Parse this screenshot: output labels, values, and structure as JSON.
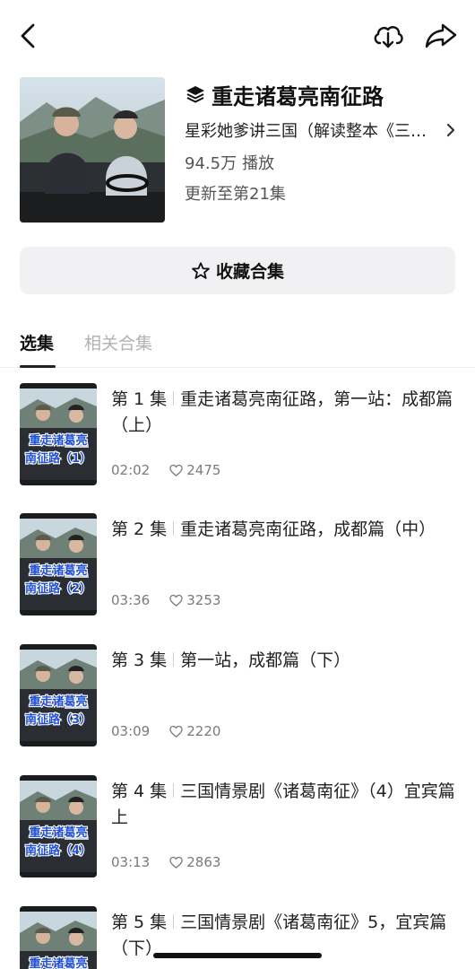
{
  "header": {
    "title": "重走诸葛亮南征路",
    "author": "星彩她爹讲三国（解读整本《三国演义》）",
    "plays": "94.5万",
    "plays_unit": "播放",
    "update_status": "更新至第21集"
  },
  "actions": {
    "collect_label": "收藏合集"
  },
  "tabs": [
    {
      "label": "选集",
      "active": true
    },
    {
      "label": "相关合集",
      "active": false
    }
  ],
  "episodes": [
    {
      "number": "第 1 集",
      "title": "重走诸葛亮南征路，第一站：成都篇（上）",
      "duration": "02:02",
      "likes": "2475",
      "thumb_caption": "重走诸葛亮\n南征路（1）"
    },
    {
      "number": "第 2 集",
      "title": "重走诸葛亮南征路，成都篇（中）",
      "duration": "03:36",
      "likes": "3253",
      "thumb_caption": "重走诸葛亮\n南征路（2）"
    },
    {
      "number": "第 3 集",
      "title": "第一站，成都篇（下）",
      "duration": "03:09",
      "likes": "2220",
      "thumb_caption": "重走诸葛亮\n南征路（3）"
    },
    {
      "number": "第 4 集",
      "title": "三国情景剧《诸葛南征》（4）宜宾篇上",
      "duration": "03:13",
      "likes": "2863",
      "thumb_caption": "重走诸葛亮\n南征路（4）"
    },
    {
      "number": "第 5 集",
      "title": "三国情景剧《诸葛南征》5，宜宾篇（下）",
      "duration": "",
      "likes": "",
      "thumb_caption": "重走诸葛亮"
    }
  ],
  "icons": {
    "back": "chevron-left-icon",
    "download": "cloud-download-icon",
    "share": "share-arrow-icon",
    "title_badge": "layers-icon",
    "author_more": "chevron-right-icon",
    "collect": "star-outline-icon",
    "likes": "heart-outline-icon"
  },
  "colors": {
    "button_bg": "#f1f1f3",
    "caption_fill": "#1e4fd6",
    "caption_stroke": "#ffffff",
    "text_secondary": "#7a7a7a",
    "tab_inactive": "#b2b2b2"
  }
}
